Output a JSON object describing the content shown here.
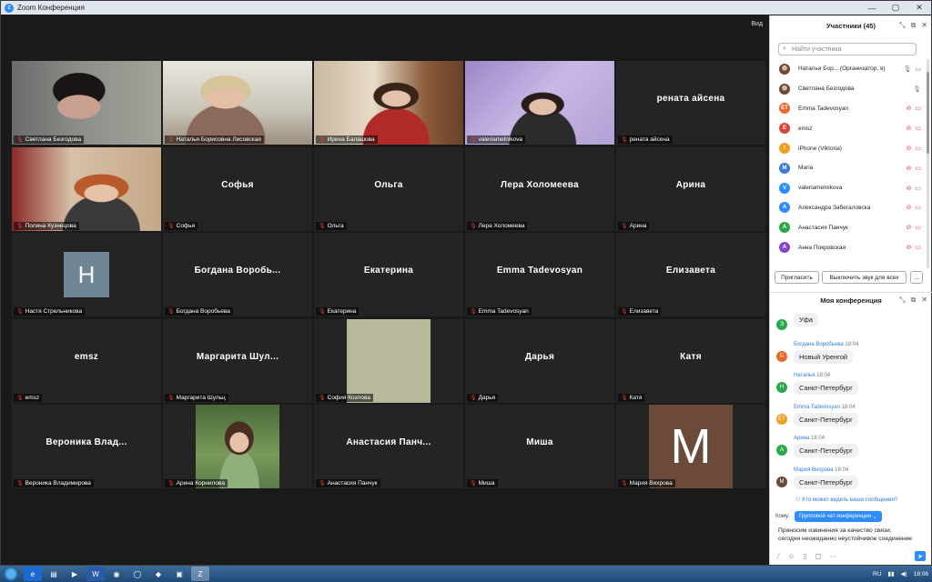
{
  "window": {
    "title": "Zoom Конференция",
    "view_label": "Вид"
  },
  "tiles": [
    {
      "name": "Светлана Безгодова",
      "video": "vid1",
      "active": true
    },
    {
      "name": "Наталья Борисовна Лисовская",
      "video": "vid2"
    },
    {
      "name": "Ирина Балашова",
      "video": "vid3"
    },
    {
      "name": "valeriamelnikova",
      "video": "vid4"
    },
    {
      "name": "рената айсена",
      "display": "рената айсена"
    },
    {
      "name": "Полина Кузнецова",
      "video": "vid5"
    },
    {
      "name": "Софья ",
      "display": "Софья "
    },
    {
      "name": "Ольга",
      "display": "Ольга"
    },
    {
      "name": "Лера Холомеева",
      "display": "Лера Холомеева"
    },
    {
      "name": "Арина",
      "display": "Арина"
    },
    {
      "name": "Настя Стрельникова",
      "avatar_letter": "H",
      "avatar_color": "#6e8593"
    },
    {
      "name": "Богдана Воробьева",
      "display": "Богдана  Воробь..."
    },
    {
      "name": "Екатерина",
      "display": "Екатерина"
    },
    {
      "name": "Emma Tadevosyan",
      "display": "Emma Tadevosyan"
    },
    {
      "name": "Елизавета",
      "display": "Елизавета"
    },
    {
      "name": "emsz",
      "display": "emsz"
    },
    {
      "name": "Маргарита Шульц",
      "display": "Маргарита  Шул..."
    },
    {
      "name": "София Козлова",
      "avatar_color": "#b8b89a"
    },
    {
      "name": "Дарья",
      "display": "Дарья"
    },
    {
      "name": "Катя",
      "display": "Катя"
    },
    {
      "name": "Вероника Владимирова",
      "display": "Вероника  Влад..."
    },
    {
      "name": "Арина Корнилова",
      "video": "vid6"
    },
    {
      "name": "Анастасия Панчук",
      "display": "Анастасия  Панч..."
    },
    {
      "name": "Миша",
      "display": "Миша"
    },
    {
      "name": "Мария Вихрова",
      "avatar_letter": "M",
      "avatar_color": "#6b4a3a"
    }
  ],
  "participants": {
    "header": "Участники (45)",
    "search_placeholder": "Найти участника",
    "items": [
      {
        "name": "Наталья Бор... (Организатор, я)",
        "initials": "",
        "color": "photo",
        "mic": "grey",
        "cam": "grey"
      },
      {
        "name": "Светлана Безгодова",
        "initials": "",
        "color": "photo",
        "mic": "grey",
        "cam": "none"
      },
      {
        "name": "Emma Tadevosyan",
        "initials": "ET",
        "color": "#e8692a",
        "mic": "red",
        "cam": "red"
      },
      {
        "name": "emsz",
        "initials": "E",
        "color": "#d9453a",
        "mic": "red",
        "cam": "red"
      },
      {
        "name": "iPhone (Viktoria)",
        "initials": "I",
        "color": "#f0a020",
        "mic": "red",
        "cam": "red"
      },
      {
        "name": "Maria",
        "initials": "M",
        "color": "#3a7ad9",
        "mic": "red",
        "cam": "red"
      },
      {
        "name": "valeriamelnikova",
        "initials": "V",
        "color": "#2d8cff",
        "mic": "red",
        "cam": "grey"
      },
      {
        "name": "Александра Забегаловска",
        "initials": "A",
        "color": "#2d8cff",
        "mic": "red",
        "cam": "red"
      },
      {
        "name": "Анастасия Панчук",
        "initials": "A",
        "color": "#2aa84a",
        "mic": "red",
        "cam": "red"
      },
      {
        "name": "Анна Покровская",
        "initials": "A",
        "color": "#8a44c8",
        "mic": "red",
        "cam": "red"
      }
    ],
    "invite_label": "Пригласить",
    "mute_all_label": "Выключить звук для всех",
    "more_label": "..."
  },
  "chat": {
    "header": "Моя конференция",
    "messages": [
      {
        "sender": "",
        "time": "",
        "text": "Уфа",
        "initial": "Э",
        "color": "#2aa84a"
      },
      {
        "sender": "Богдана Воробьева",
        "time": "18:04",
        "text": "Новый Уренгой",
        "initial": "Б",
        "color": "#e8692a"
      },
      {
        "sender": "Наталья",
        "time": "18:04",
        "text": "Санкт-Петербург",
        "initial": "Н",
        "color": "#2aa84a"
      },
      {
        "sender": "Emma Tadevosyan",
        "time": "18:04",
        "text": "Санкт-Петербург",
        "initial": "ET",
        "color": "#f0a020"
      },
      {
        "sender": "Арина",
        "time": "18:04",
        "text": "Санкт-Петербург",
        "initial": "А",
        "color": "#2aa84a"
      },
      {
        "sender": "Мария Вихрова",
        "time": "18:04",
        "text": "Санкт-Петербург",
        "initial": "М",
        "color": "#6b4a3a"
      }
    ],
    "who_can_see": "Кто может видеть ваши сообщения?",
    "to_label": "Кому:",
    "to_value": "Групповой чат конференции",
    "draft_line1": "Приносим извинения за качество связи,",
    "draft_line2": "сегодня неожиданно неустойчивое соединение"
  },
  "taskbar": {
    "lang": "RU",
    "clock": "18:06"
  }
}
